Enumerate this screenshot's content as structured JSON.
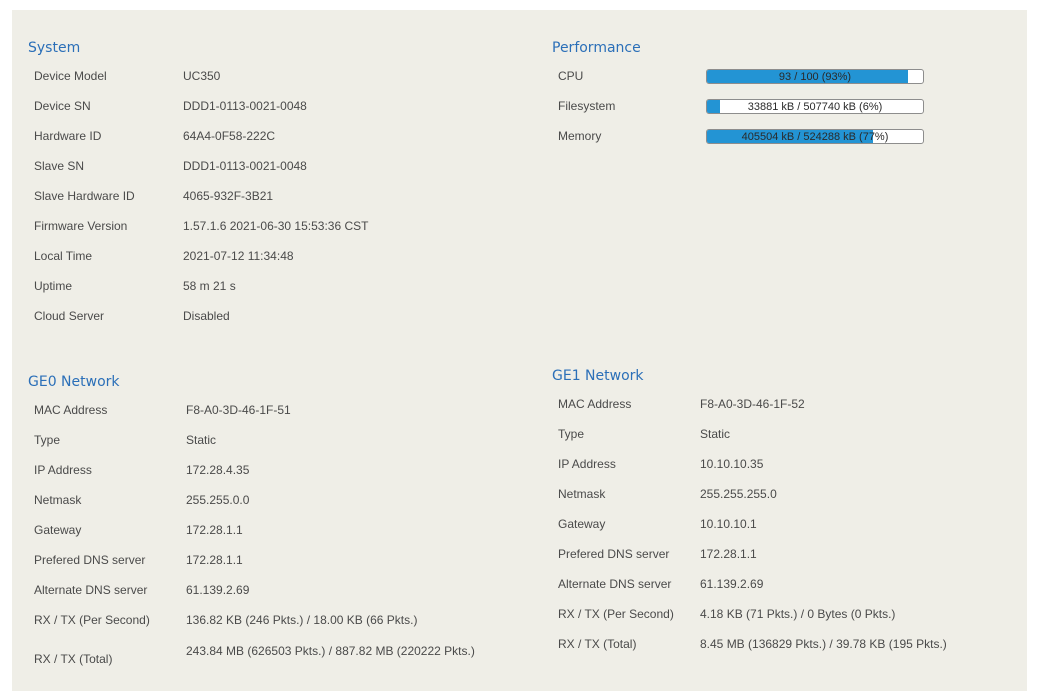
{
  "system": {
    "title": "System",
    "rows": [
      {
        "label": "Device Model",
        "value": "UC350"
      },
      {
        "label": "Device SN",
        "value": "DDD1-0113-0021-0048"
      },
      {
        "label": "Hardware ID",
        "value": "64A4-0F58-222C"
      },
      {
        "label": "Slave SN",
        "value": "DDD1-0113-0021-0048"
      },
      {
        "label": "Slave Hardware ID",
        "value": "4065-932F-3B21"
      },
      {
        "label": "Firmware Version",
        "value": "1.57.1.6 2021-06-30 15:53:36 CST"
      },
      {
        "label": "Local Time",
        "value": "2021-07-12 11:34:48"
      },
      {
        "label": "Uptime",
        "value": "58 m 21 s"
      },
      {
        "label": "Cloud Server",
        "value": "Disabled"
      }
    ]
  },
  "performance": {
    "title": "Performance",
    "rows": [
      {
        "label": "CPU",
        "text": "93 / 100 (93%)",
        "percent": 93
      },
      {
        "label": "Filesystem",
        "text": "33881 kB / 507740 kB (6%)",
        "percent": 6
      },
      {
        "label": "Memory",
        "text": "405504 kB / 524288 kB (77%)",
        "percent": 77
      }
    ]
  },
  "ge0": {
    "title": "GE0 Network",
    "rows": [
      {
        "label": "MAC Address",
        "value": "F8-A0-3D-46-1F-51"
      },
      {
        "label": "Type",
        "value": "Static"
      },
      {
        "label": "IP Address",
        "value": "172.28.4.35"
      },
      {
        "label": "Netmask",
        "value": "255.255.0.0"
      },
      {
        "label": "Gateway",
        "value": "172.28.1.1"
      },
      {
        "label": "Prefered DNS server",
        "value": "172.28.1.1"
      },
      {
        "label": "Alternate DNS server",
        "value": "61.139.2.69"
      },
      {
        "label": "RX / TX (Per Second)",
        "value": "136.82 KB (246 Pkts.) / 18.00 KB (66 Pkts.)"
      },
      {
        "label": "RX / TX (Total)",
        "value": "243.84 MB (626503 Pkts.) / 887.82 MB (220222 Pkts.)"
      }
    ]
  },
  "ge1": {
    "title": "GE1 Network",
    "rows": [
      {
        "label": "MAC Address",
        "value": "F8-A0-3D-46-1F-52"
      },
      {
        "label": "Type",
        "value": "Static"
      },
      {
        "label": "IP Address",
        "value": "10.10.10.35"
      },
      {
        "label": "Netmask",
        "value": "255.255.255.0"
      },
      {
        "label": "Gateway",
        "value": "10.10.10.1"
      },
      {
        "label": "Prefered DNS server",
        "value": "172.28.1.1"
      },
      {
        "label": "Alternate DNS server",
        "value": "61.139.2.69"
      },
      {
        "label": "RX / TX (Per Second)",
        "value": "4.18 KB (71 Pkts.) / 0 Bytes (0 Pkts.)"
      },
      {
        "label": "RX / TX (Total)",
        "value": "8.45 MB (136829 Pkts.) / 39.78 KB (195 Pkts.)"
      }
    ]
  },
  "colors": {
    "panel_background": "#efeee7",
    "section_title": "#2b6fb8",
    "bar_fill": "#2394d4"
  }
}
